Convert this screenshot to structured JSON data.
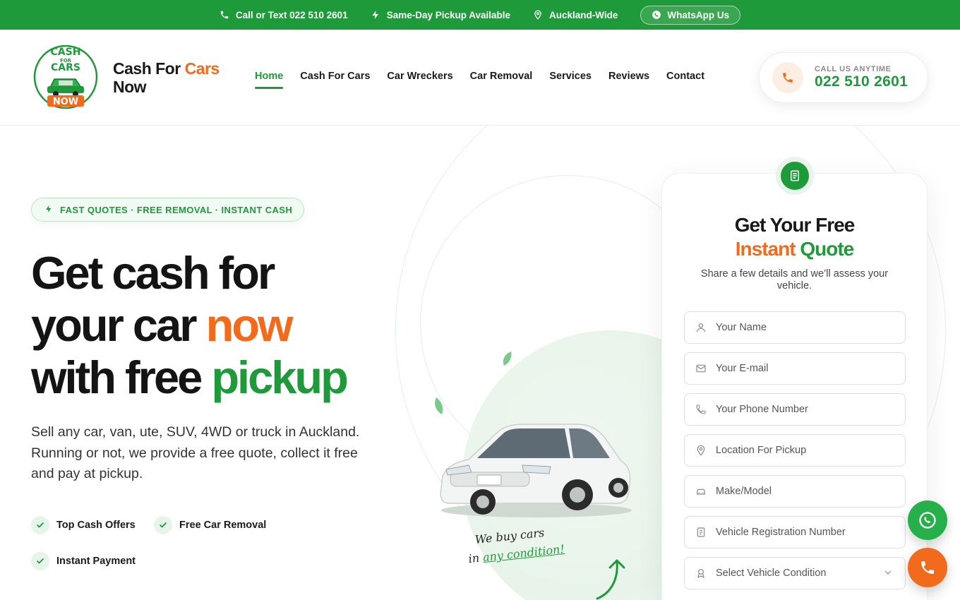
{
  "topbar": {
    "call": "Call or Text 022 510 2601",
    "pickup": "Same-Day Pickup Available",
    "area": "Auckland-Wide",
    "whatsapp": "WhatsApp Us"
  },
  "logo": {
    "line1": "CASH",
    "line2": "FOR",
    "line3": "CARS",
    "line4": "NOW"
  },
  "brand": {
    "part1": "Cash For",
    "part2": "Cars",
    "part3": "Now"
  },
  "nav": {
    "items": [
      "Home",
      "Cash For Cars",
      "Car Wreckers",
      "Car Removal",
      "Services",
      "Reviews",
      "Contact"
    ],
    "active": "Home"
  },
  "call_card": {
    "label": "CALL US ANYTIME",
    "number": "022 510 2601"
  },
  "hero": {
    "pill": "FAST QUOTES · FREE REMOVAL · INSTANT CASH",
    "headline_line1": "Get cash for",
    "headline_line2a": "your car",
    "headline_line2b": "now",
    "headline_line3a": "with free",
    "headline_line3b": "pickup",
    "subtext": "Sell any car, van, ute, SUV, 4WD or truck in Auckland. Running or not, we provide a free quote, collect it free and pay at pickup.",
    "features": [
      "Top Cash Offers",
      "Free Car Removal",
      "Instant Payment"
    ],
    "tagline1": "We buy cars",
    "tagline2a": "in",
    "tagline2b": "any condition!"
  },
  "quote": {
    "title_line1": "Get Your Free",
    "title_instant": "Instant",
    "title_quote": "Quote",
    "description": "Share a few details and we’ll assess your vehicle.",
    "fields": [
      {
        "placeholder": "Your Name",
        "icon": "user-icon"
      },
      {
        "placeholder": "Your E-mail",
        "icon": "mail-icon"
      },
      {
        "placeholder": "Your Phone Number",
        "icon": "phone-icon"
      },
      {
        "placeholder": "Location For Pickup",
        "icon": "location-icon"
      },
      {
        "placeholder": "Make/Model",
        "icon": "car-icon"
      },
      {
        "placeholder": "Vehicle Registration Number",
        "icon": "document-icon"
      },
      {
        "placeholder": "Select Vehicle Condition",
        "icon": "condition-icon"
      }
    ]
  },
  "colors": {
    "green": "#1f9a3a",
    "orange": "#f26b1d",
    "whatsapp_green": "#25b04a"
  }
}
